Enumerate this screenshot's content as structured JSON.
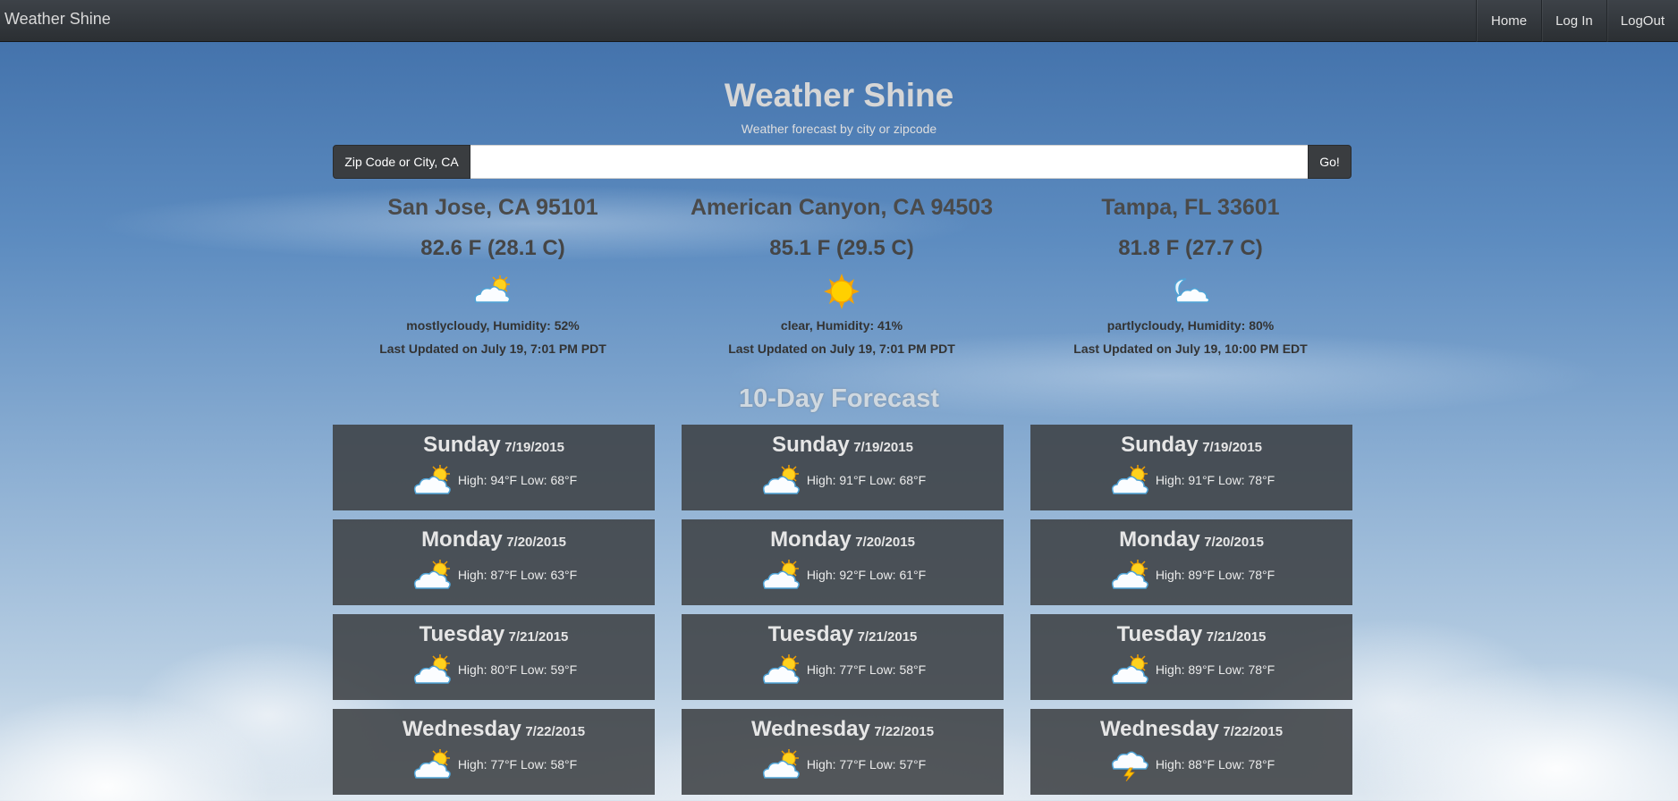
{
  "navbar": {
    "brand": "Weather Shine",
    "links": [
      "Home",
      "Log In",
      "LogOut"
    ]
  },
  "header": {
    "title": "Weather Shine",
    "subtitle": "Weather forecast by city or zipcode"
  },
  "search": {
    "label": "Zip Code or City, CA",
    "value": "",
    "button": "Go!"
  },
  "current": [
    {
      "location": "San Jose, CA 95101",
      "temp": "82.6 F (28.1 C)",
      "icon": "mostly-cloudy-icon",
      "conditions": "mostlycloudy, Humidity: 52%",
      "updated": "Last Updated on July 19, 7:01 PM PDT"
    },
    {
      "location": "American Canyon, CA 94503",
      "temp": "85.1 F (29.5 C)",
      "icon": "sun-icon",
      "conditions": "clear, Humidity: 41%",
      "updated": "Last Updated on July 19, 7:01 PM PDT"
    },
    {
      "location": "Tampa, FL 33601",
      "temp": "81.8 F (27.7 C)",
      "icon": "moon-cloud-icon",
      "conditions": "partlycloudy, Humidity: 80%",
      "updated": "Last Updated on July 19, 10:00 PM EDT"
    }
  ],
  "forecast_title": "10-Day Forecast",
  "forecast": [
    [
      {
        "day": "Sunday",
        "date": "7/19/2015",
        "text": "High: 94°F Low: 68°F",
        "icon": "partly-cloudy-icon"
      },
      {
        "day": "Monday",
        "date": "7/20/2015",
        "text": "High: 87°F Low: 63°F",
        "icon": "partly-cloudy-icon"
      },
      {
        "day": "Tuesday",
        "date": "7/21/2015",
        "text": "High: 80°F Low: 59°F",
        "icon": "partly-cloudy-icon"
      },
      {
        "day": "Wednesday",
        "date": "7/22/2015",
        "text": "High: 77°F Low: 58°F",
        "icon": "partly-cloudy-icon"
      }
    ],
    [
      {
        "day": "Sunday",
        "date": "7/19/2015",
        "text": "High: 91°F Low: 68°F",
        "icon": "partly-cloudy-icon"
      },
      {
        "day": "Monday",
        "date": "7/20/2015",
        "text": "High: 92°F Low: 61°F",
        "icon": "partly-cloudy-icon"
      },
      {
        "day": "Tuesday",
        "date": "7/21/2015",
        "text": "High: 77°F Low: 58°F",
        "icon": "partly-cloudy-icon"
      },
      {
        "day": "Wednesday",
        "date": "7/22/2015",
        "text": "High: 77°F Low: 57°F",
        "icon": "partly-cloudy-icon"
      }
    ],
    [
      {
        "day": "Sunday",
        "date": "7/19/2015",
        "text": "High: 91°F Low: 78°F",
        "icon": "partly-cloudy-icon"
      },
      {
        "day": "Monday",
        "date": "7/20/2015",
        "text": "High: 89°F Low: 78°F",
        "icon": "partly-cloudy-icon"
      },
      {
        "day": "Tuesday",
        "date": "7/21/2015",
        "text": "High: 89°F Low: 78°F",
        "icon": "partly-cloudy-icon"
      },
      {
        "day": "Wednesday",
        "date": "7/22/2015",
        "text": "High: 88°F Low: 78°F",
        "icon": "thunderstorm-icon"
      }
    ]
  ]
}
